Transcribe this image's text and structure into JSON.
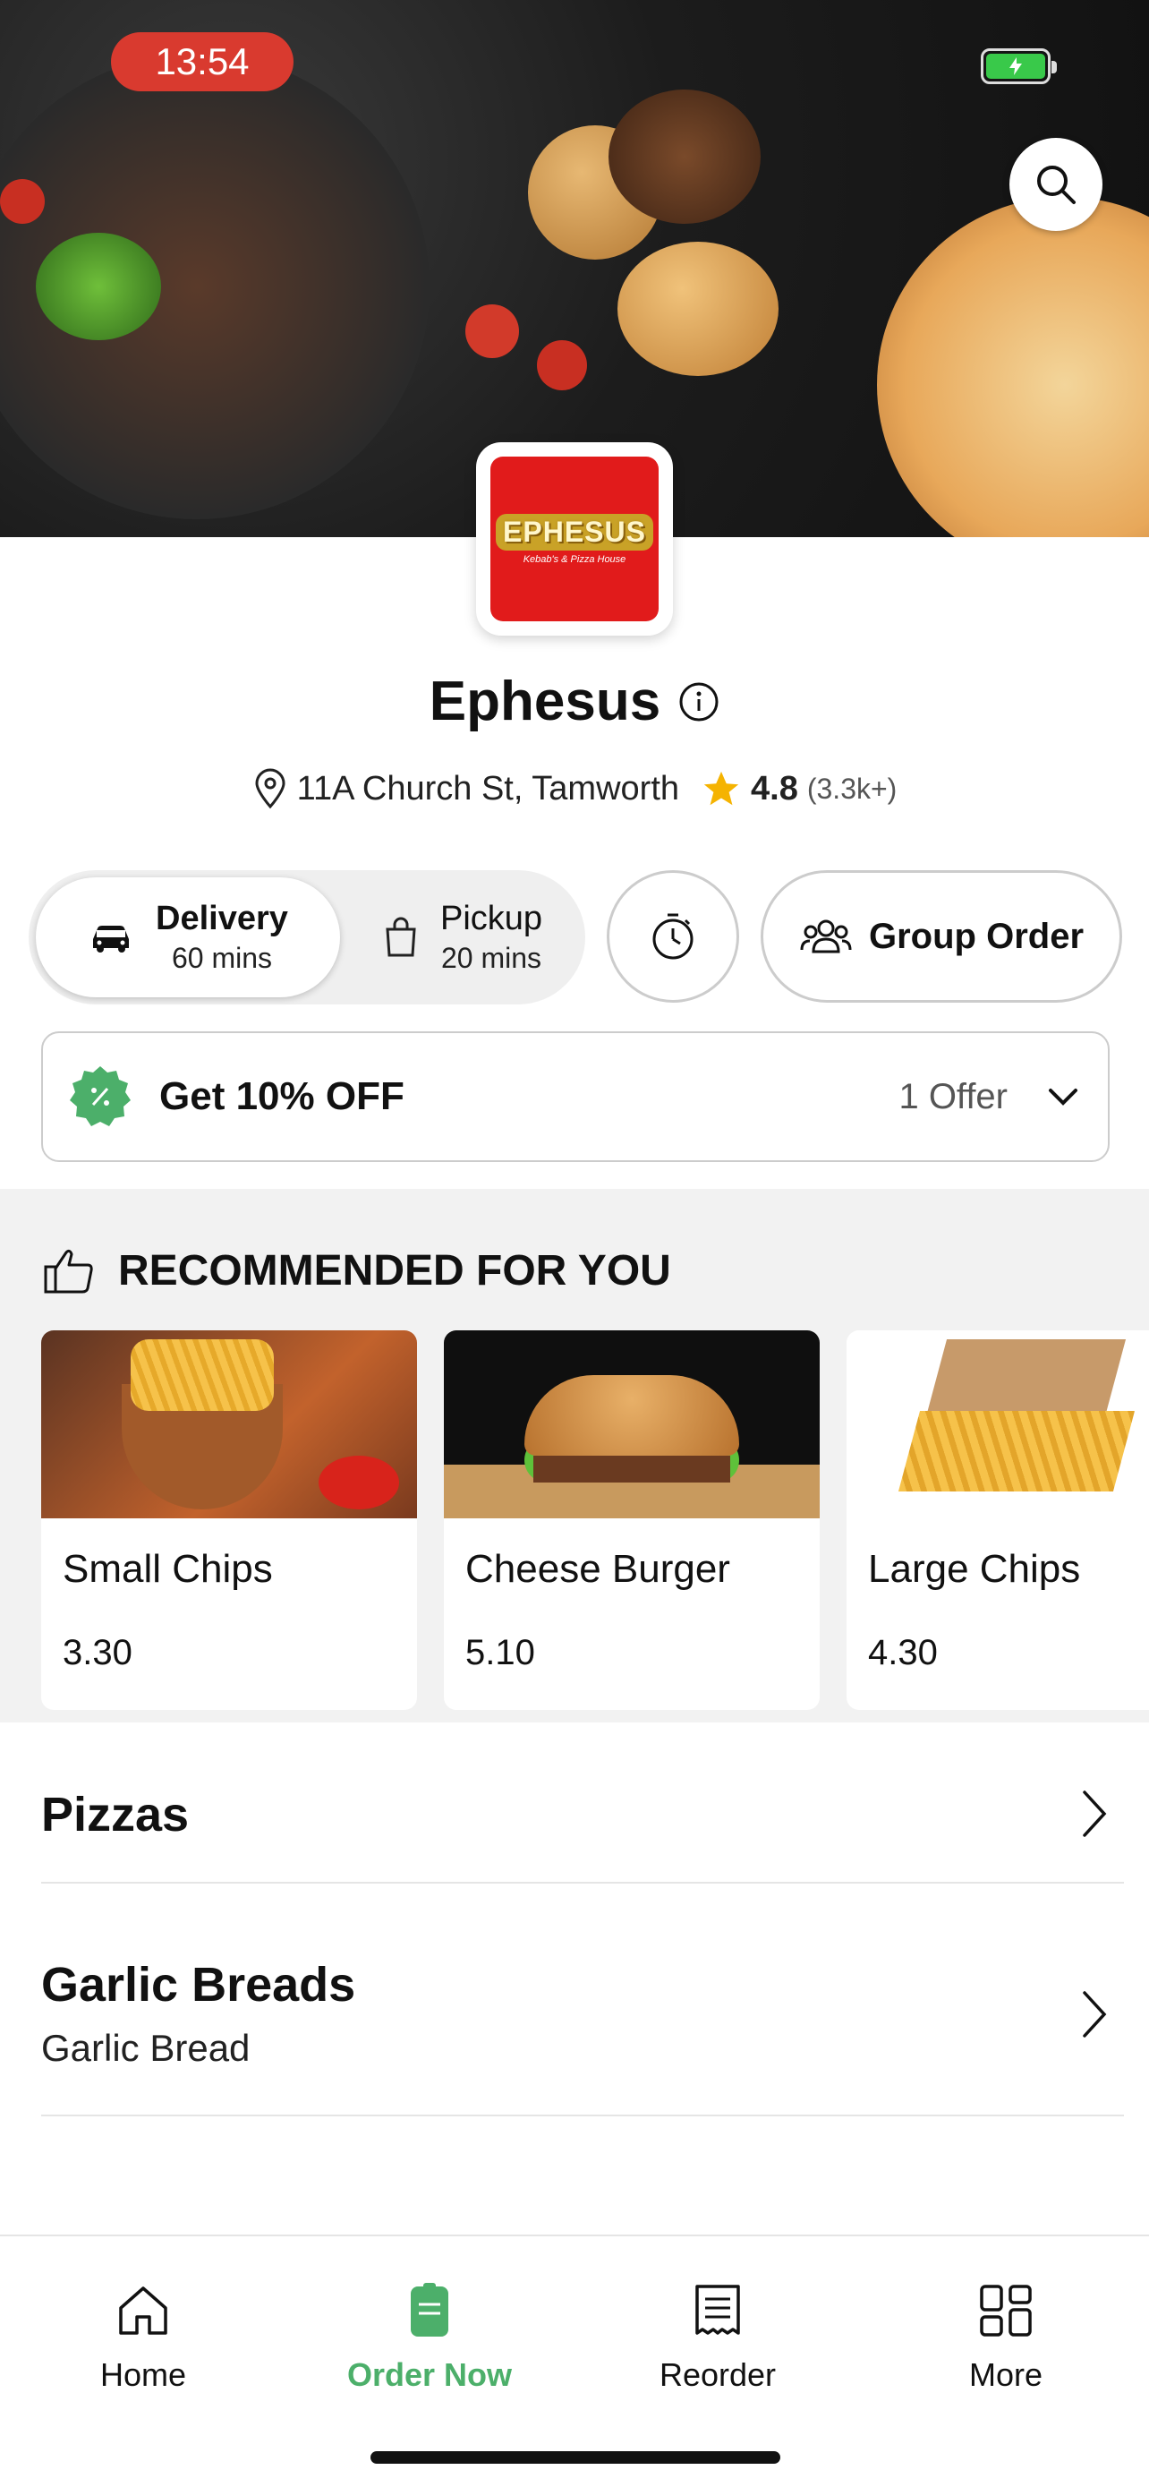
{
  "status_bar": {
    "time": "13:54"
  },
  "restaurant": {
    "logo_text": "EPHESUS",
    "logo_subtext": "Kebab's & Pizza House",
    "name": "Ephesus",
    "address": "11A Church St, Tamworth",
    "rating": "4.8",
    "rating_count": "(3.3k+)"
  },
  "order_mode": {
    "delivery": {
      "label": "Delivery",
      "time": "60 mins",
      "selected": true
    },
    "pickup": {
      "label": "Pickup",
      "time": "20 mins",
      "selected": false
    },
    "group_order_label": "Group Order"
  },
  "offer": {
    "title": "Get 10% OFF",
    "count": "1 Offer"
  },
  "recommended": {
    "heading": "RECOMMENDED FOR YOU",
    "items": [
      {
        "name": "Small Chips",
        "price": "3.30"
      },
      {
        "name": "Cheese Burger",
        "price": "5.10"
      },
      {
        "name": "Large Chips",
        "price": "4.30"
      }
    ]
  },
  "categories": [
    {
      "title": "Pizzas",
      "subtitle": ""
    },
    {
      "title": "Garlic Breads",
      "subtitle": "Garlic Bread"
    }
  ],
  "bottom_nav": {
    "items": [
      {
        "label": "Home",
        "icon": "home-icon",
        "active": false
      },
      {
        "label": "Order Now",
        "icon": "order-icon",
        "active": true
      },
      {
        "label": "Reorder",
        "icon": "receipt-icon",
        "active": false
      },
      {
        "label": "More",
        "icon": "grid-icon",
        "active": false
      }
    ]
  },
  "colors": {
    "accent_green": "#4caf6a",
    "logo_red": "#e11b1b",
    "time_pill_red": "#d93a2f",
    "star_gold": "#f5b301"
  }
}
